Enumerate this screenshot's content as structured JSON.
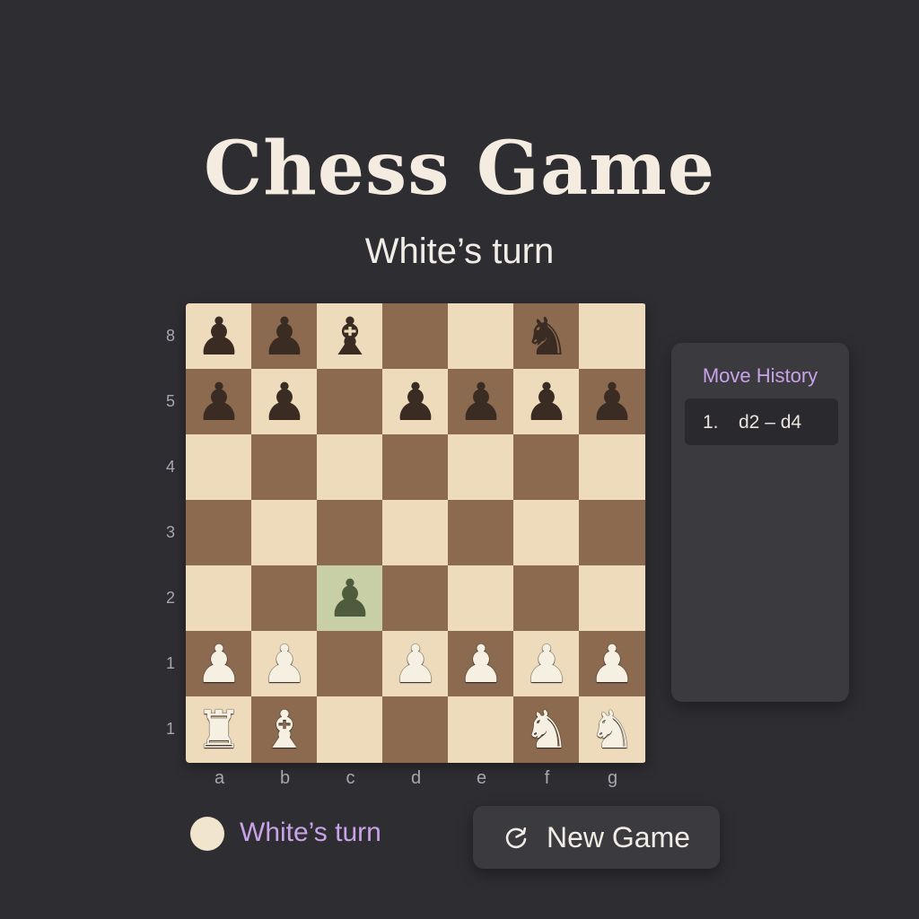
{
  "header": {
    "title": "Chess Game",
    "subtitle": "White’s turn"
  },
  "board": {
    "rank_labels": [
      "8",
      "5",
      "4",
      "3",
      "2",
      "1",
      "1"
    ],
    "file_labels": [
      "a",
      "b",
      "c",
      "d",
      "e",
      "f",
      "g"
    ],
    "squares": [
      {
        "id": "sq-1-1",
        "shade": "light",
        "piece": "♟",
        "side": "black",
        "name": "black-pawn"
      },
      {
        "id": "sq-1-2",
        "shade": "dark",
        "piece": "♟",
        "side": "black",
        "name": "black-pawn"
      },
      {
        "id": "sq-1-3",
        "shade": "light",
        "piece": "♝",
        "side": "black",
        "name": "black-bishop"
      },
      {
        "id": "sq-1-4",
        "shade": "dark",
        "piece": "",
        "side": "",
        "name": ""
      },
      {
        "id": "sq-1-5",
        "shade": "light",
        "piece": "",
        "side": "",
        "name": ""
      },
      {
        "id": "sq-1-6",
        "shade": "dark",
        "piece": "♞",
        "side": "black",
        "name": "black-knight"
      },
      {
        "id": "sq-1-7",
        "shade": "light",
        "piece": "",
        "side": "",
        "name": ""
      },
      {
        "id": "sq-2-1",
        "shade": "dark",
        "piece": "♟",
        "side": "black",
        "name": "black-pawn"
      },
      {
        "id": "sq-2-2",
        "shade": "light",
        "piece": "♟",
        "side": "black",
        "name": "black-pawn"
      },
      {
        "id": "sq-2-3",
        "shade": "dark",
        "piece": "",
        "side": "",
        "name": ""
      },
      {
        "id": "sq-2-4",
        "shade": "light",
        "piece": "♟",
        "side": "black",
        "name": "black-pawn"
      },
      {
        "id": "sq-2-5",
        "shade": "dark",
        "piece": "♟",
        "side": "black",
        "name": "black-pawn"
      },
      {
        "id": "sq-2-6",
        "shade": "light",
        "piece": "♟",
        "side": "black",
        "name": "black-pawn"
      },
      {
        "id": "sq-2-7",
        "shade": "dark",
        "piece": "♟",
        "side": "black",
        "name": "black-pawn"
      },
      {
        "id": "sq-3-1",
        "shade": "light",
        "piece": "",
        "side": "",
        "name": ""
      },
      {
        "id": "sq-3-2",
        "shade": "dark",
        "piece": "",
        "side": "",
        "name": ""
      },
      {
        "id": "sq-3-3",
        "shade": "light",
        "piece": "",
        "side": "",
        "name": ""
      },
      {
        "id": "sq-3-4",
        "shade": "dark",
        "piece": "",
        "side": "",
        "name": ""
      },
      {
        "id": "sq-3-5",
        "shade": "light",
        "piece": "",
        "side": "",
        "name": ""
      },
      {
        "id": "sq-3-6",
        "shade": "dark",
        "piece": "",
        "side": "",
        "name": ""
      },
      {
        "id": "sq-3-7",
        "shade": "light",
        "piece": "",
        "side": "",
        "name": ""
      },
      {
        "id": "sq-4-1",
        "shade": "dark",
        "piece": "",
        "side": "",
        "name": ""
      },
      {
        "id": "sq-4-2",
        "shade": "light",
        "piece": "",
        "side": "",
        "name": ""
      },
      {
        "id": "sq-4-3",
        "shade": "dark",
        "piece": "",
        "side": "",
        "name": ""
      },
      {
        "id": "sq-4-4",
        "shade": "light",
        "piece": "",
        "side": "",
        "name": ""
      },
      {
        "id": "sq-4-5",
        "shade": "dark",
        "piece": "",
        "side": "",
        "name": ""
      },
      {
        "id": "sq-4-6",
        "shade": "light",
        "piece": "",
        "side": "",
        "name": ""
      },
      {
        "id": "sq-4-7",
        "shade": "dark",
        "piece": "",
        "side": "",
        "name": ""
      },
      {
        "id": "sq-5-1",
        "shade": "light",
        "piece": "",
        "side": "",
        "name": ""
      },
      {
        "id": "sq-5-2",
        "shade": "dark",
        "piece": "",
        "side": "",
        "name": ""
      },
      {
        "id": "sq-5-3",
        "shade": "highlight",
        "piece": "♟",
        "side": "green",
        "name": "moved-pawn"
      },
      {
        "id": "sq-5-4",
        "shade": "dark",
        "piece": "",
        "side": "",
        "name": ""
      },
      {
        "id": "sq-5-5",
        "shade": "light",
        "piece": "",
        "side": "",
        "name": ""
      },
      {
        "id": "sq-5-6",
        "shade": "dark",
        "piece": "",
        "side": "",
        "name": ""
      },
      {
        "id": "sq-5-7",
        "shade": "light",
        "piece": "",
        "side": "",
        "name": ""
      },
      {
        "id": "sq-6-1",
        "shade": "dark",
        "piece": "♟",
        "side": "white",
        "name": "white-pawn"
      },
      {
        "id": "sq-6-2",
        "shade": "light",
        "piece": "♟",
        "side": "white",
        "name": "white-pawn"
      },
      {
        "id": "sq-6-3",
        "shade": "dark",
        "piece": "",
        "side": "",
        "name": ""
      },
      {
        "id": "sq-6-4",
        "shade": "light",
        "piece": "♟",
        "side": "white",
        "name": "white-pawn"
      },
      {
        "id": "sq-6-5",
        "shade": "dark",
        "piece": "♟",
        "side": "white",
        "name": "white-pawn"
      },
      {
        "id": "sq-6-6",
        "shade": "light",
        "piece": "♟",
        "side": "white",
        "name": "white-pawn"
      },
      {
        "id": "sq-6-7",
        "shade": "dark",
        "piece": "♟",
        "side": "white",
        "name": "white-pawn"
      },
      {
        "id": "sq-7-1",
        "shade": "light",
        "piece": "♜",
        "side": "white",
        "name": "white-rook"
      },
      {
        "id": "sq-7-2",
        "shade": "dark",
        "piece": "♝",
        "side": "white",
        "name": "white-bishop"
      },
      {
        "id": "sq-7-3",
        "shade": "light",
        "piece": "",
        "side": "",
        "name": ""
      },
      {
        "id": "sq-7-4",
        "shade": "dark",
        "piece": "",
        "side": "",
        "name": ""
      },
      {
        "id": "sq-7-5",
        "shade": "light",
        "piece": "",
        "side": "",
        "name": ""
      },
      {
        "id": "sq-7-6",
        "shade": "dark",
        "piece": "♞",
        "side": "white",
        "name": "white-knight"
      },
      {
        "id": "sq-7-7",
        "shade": "light",
        "piece": "♞",
        "side": "white",
        "name": "white-knight"
      }
    ]
  },
  "move_history": {
    "title": "Move History",
    "moves": [
      {
        "number": "1.",
        "move": "d2 – d4"
      }
    ]
  },
  "status": {
    "turn_text": "White’s turn",
    "turn_color": "#f1e5cd"
  },
  "actions": {
    "new_game_label": "New Game",
    "new_game_icon": "refresh-icon"
  },
  "colors": {
    "background": "#2e2d32",
    "light_square": "#eddbbb",
    "dark_square": "#8b6a4f",
    "highlight_square": "#c8cfa7",
    "accent": "#c9a3e8"
  }
}
